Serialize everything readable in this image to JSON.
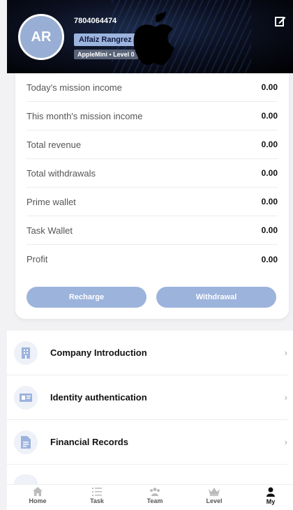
{
  "header": {
    "avatar_initials": "AR",
    "phone": "7804064474",
    "name": "Alfaiz Rangrez",
    "level": "AppleMini • Level 0"
  },
  "stats": [
    {
      "label": "Today's mission income",
      "value": "0.00"
    },
    {
      "label": "This month's mission income",
      "value": "0.00"
    },
    {
      "label": "Total revenue",
      "value": "0.00"
    },
    {
      "label": "Total withdrawals",
      "value": "0.00"
    },
    {
      "label": "Prime wallet",
      "value": "0.00"
    },
    {
      "label": "Task Wallet",
      "value": "0.00"
    },
    {
      "label": "Profit",
      "value": "0.00"
    }
  ],
  "actions": {
    "recharge": "Recharge",
    "withdrawal": "Withdrawal"
  },
  "menu": [
    {
      "label": "Company Introduction",
      "icon": "building-icon"
    },
    {
      "label": "Identity authentication",
      "icon": "id-card-icon"
    },
    {
      "label": "Financial Records",
      "icon": "document-icon"
    }
  ],
  "nav": [
    {
      "label": "Home",
      "icon": "home-icon"
    },
    {
      "label": "Task",
      "icon": "task-list-icon"
    },
    {
      "label": "Team",
      "icon": "team-icon"
    },
    {
      "label": "Level",
      "icon": "crown-icon"
    },
    {
      "label": "My",
      "icon": "user-icon"
    }
  ],
  "colors": {
    "accent": "#9cb3dc",
    "avatar": "#98aed5",
    "header_bg": "#000000"
  }
}
